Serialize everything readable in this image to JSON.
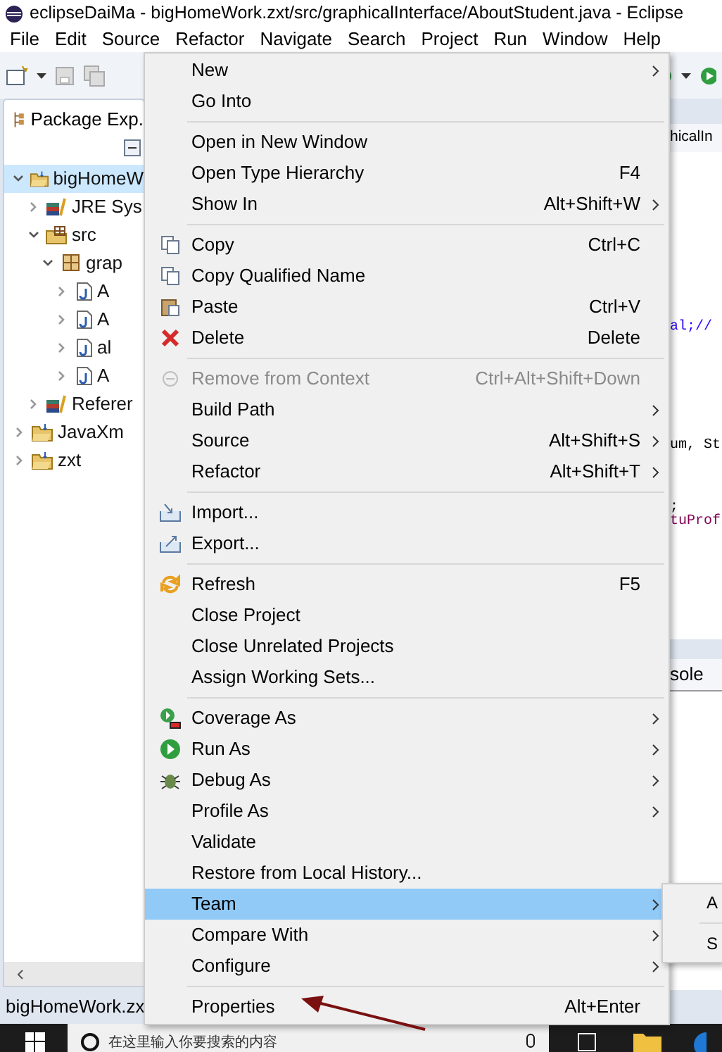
{
  "window": {
    "title": "eclipseDaiMa - bigHomeWork.zxt/src/graphicalInterface/AboutStudent.java - Eclipse"
  },
  "menubar": [
    "File",
    "Edit",
    "Source",
    "Refactor",
    "Navigate",
    "Search",
    "Project",
    "Run",
    "Window",
    "Help"
  ],
  "explorer": {
    "title": "Package Exp.",
    "tree": [
      {
        "label": "bigHomeW",
        "kind": "project",
        "expanded": true,
        "selected": true,
        "children": [
          {
            "label": "JRE Sys",
            "kind": "library",
            "expanded": false,
            "selected": false
          },
          {
            "label": "src",
            "kind": "srcfolder",
            "expanded": true,
            "selected": false,
            "children": [
              {
                "label": "grap",
                "kind": "package",
                "expanded": true,
                "selected": false,
                "children": [
                  {
                    "label": "A",
                    "kind": "java",
                    "expanded": false,
                    "selected": false
                  },
                  {
                    "label": "A",
                    "kind": "java",
                    "expanded": false,
                    "selected": false
                  },
                  {
                    "label": "al",
                    "kind": "java",
                    "expanded": false,
                    "selected": false
                  },
                  {
                    "label": "A",
                    "kind": "java",
                    "expanded": false,
                    "selected": false
                  }
                ]
              }
            ]
          },
          {
            "label": "Referer",
            "kind": "library",
            "expanded": false,
            "selected": false
          }
        ]
      },
      {
        "label": "JavaXm",
        "kind": "project",
        "expanded": false,
        "selected": false
      },
      {
        "label": "zxt",
        "kind": "project",
        "expanded": false,
        "selected": false
      }
    ]
  },
  "editor": {
    "tab": "hicalIn",
    "code_lines": [
      {
        "text": "al;//",
        "kind": "keyword"
      },
      {
        "text": "um, St",
        "kind": "plain"
      },
      {
        "text": ";",
        "kind": "plain"
      },
      {
        "text": "tuProf",
        "kind": "field"
      }
    ],
    "console_tab": "sole"
  },
  "context_menu": [
    {
      "kind": "plain",
      "label": "New",
      "submenu": true,
      "disabled": false,
      "selected": false
    },
    {
      "kind": "plain",
      "label": "Go Into",
      "submenu": false,
      "disabled": false,
      "selected": false
    },
    {
      "kind": "separator"
    },
    {
      "kind": "plain",
      "label": "Open in New Window",
      "submenu": false,
      "disabled": false,
      "selected": false
    },
    {
      "kind": "plain",
      "label": "Open Type Hierarchy",
      "shortcut": "F4",
      "submenu": false,
      "disabled": false,
      "selected": false
    },
    {
      "kind": "plain",
      "label": "Show In",
      "shortcut": "Alt+Shift+W",
      "submenu": true,
      "disabled": false,
      "selected": false
    },
    {
      "kind": "separator"
    },
    {
      "kind": "copy",
      "label": "Copy",
      "shortcut": "Ctrl+C",
      "submenu": false,
      "disabled": false,
      "selected": false
    },
    {
      "kind": "copy",
      "label": "Copy Qualified Name",
      "submenu": false,
      "disabled": false,
      "selected": false
    },
    {
      "kind": "paste",
      "label": "Paste",
      "shortcut": "Ctrl+V",
      "submenu": false,
      "disabled": false,
      "selected": false
    },
    {
      "kind": "delete",
      "label": "Delete",
      "shortcut": "Delete",
      "submenu": false,
      "disabled": false,
      "selected": false
    },
    {
      "kind": "separator"
    },
    {
      "kind": "remove",
      "label": "Remove from Context",
      "shortcut": "Ctrl+Alt+Shift+Down",
      "submenu": false,
      "disabled": true,
      "selected": false
    },
    {
      "kind": "plain",
      "label": "Build Path",
      "submenu": true,
      "disabled": false,
      "selected": false
    },
    {
      "kind": "plain",
      "label": "Source",
      "shortcut": "Alt+Shift+S",
      "submenu": true,
      "disabled": false,
      "selected": false
    },
    {
      "kind": "plain",
      "label": "Refactor",
      "shortcut": "Alt+Shift+T",
      "submenu": true,
      "disabled": false,
      "selected": false
    },
    {
      "kind": "separator"
    },
    {
      "kind": "import",
      "label": "Import...",
      "submenu": false,
      "disabled": false,
      "selected": false
    },
    {
      "kind": "export",
      "label": "Export...",
      "submenu": false,
      "disabled": false,
      "selected": false
    },
    {
      "kind": "separator"
    },
    {
      "kind": "refresh",
      "label": "Refresh",
      "shortcut": "F5",
      "submenu": false,
      "disabled": false,
      "selected": false
    },
    {
      "kind": "plain",
      "label": "Close Project",
      "submenu": false,
      "disabled": false,
      "selected": false
    },
    {
      "kind": "plain",
      "label": "Close Unrelated Projects",
      "submenu": false,
      "disabled": false,
      "selected": false
    },
    {
      "kind": "plain",
      "label": "Assign Working Sets...",
      "submenu": false,
      "disabled": false,
      "selected": false
    },
    {
      "kind": "separator"
    },
    {
      "kind": "coverage",
      "label": "Coverage As",
      "submenu": true,
      "disabled": false,
      "selected": false
    },
    {
      "kind": "run",
      "label": "Run As",
      "submenu": true,
      "disabled": false,
      "selected": false
    },
    {
      "kind": "debug",
      "label": "Debug As",
      "submenu": true,
      "disabled": false,
      "selected": false
    },
    {
      "kind": "plain",
      "label": "Profile As",
      "submenu": true,
      "disabled": false,
      "selected": false
    },
    {
      "kind": "plain",
      "label": "Validate",
      "submenu": false,
      "disabled": false,
      "selected": false
    },
    {
      "kind": "plain",
      "label": "Restore from Local History...",
      "submenu": false,
      "disabled": false,
      "selected": false
    },
    {
      "kind": "plain",
      "label": "Team",
      "submenu": true,
      "disabled": false,
      "selected": true
    },
    {
      "kind": "plain",
      "label": "Compare With",
      "submenu": true,
      "disabled": false,
      "selected": false
    },
    {
      "kind": "plain",
      "label": "Configure",
      "submenu": true,
      "disabled": false,
      "selected": false
    },
    {
      "kind": "separator"
    },
    {
      "kind": "plain",
      "label": "Properties",
      "shortcut": "Alt+Enter",
      "submenu": false,
      "disabled": false,
      "selected": false
    }
  ],
  "submenu": [
    {
      "kind": "item",
      "label": "A"
    },
    {
      "kind": "separator"
    },
    {
      "kind": "item",
      "label": "S"
    }
  ],
  "status_bar": {
    "text": "bigHomeWork.zx"
  },
  "taskbar": {
    "search_placeholder": "在这里输入你要搜索的内容"
  }
}
